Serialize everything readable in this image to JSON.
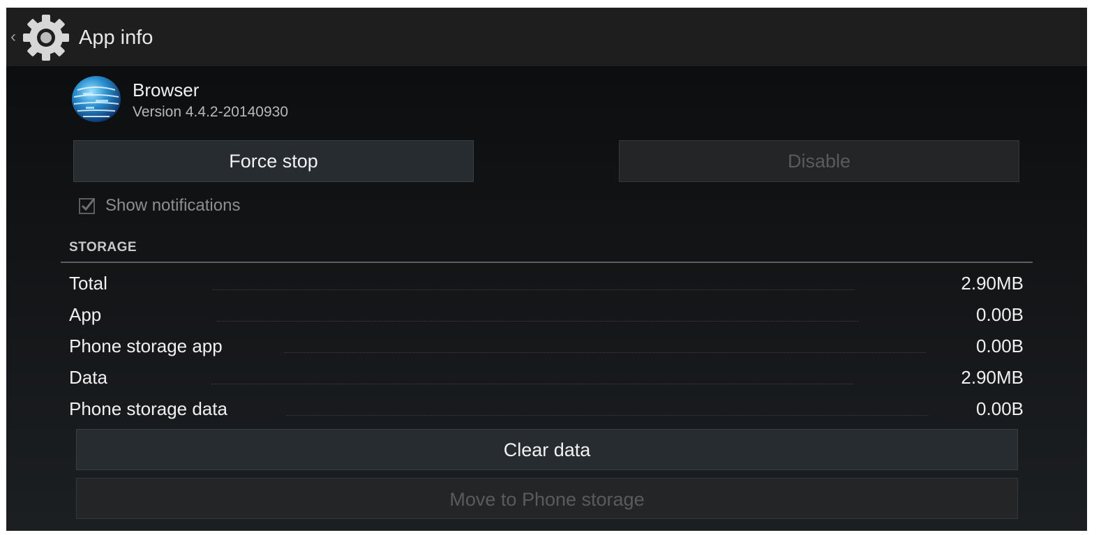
{
  "action_bar": {
    "title": "App info",
    "icon": "gear-icon"
  },
  "app": {
    "name": "Browser",
    "version": "Version 4.4.2-20140930",
    "icon": "globe-icon"
  },
  "buttons": {
    "force_stop": "Force stop",
    "disable": "Disable",
    "clear_data": "Clear data",
    "move_storage": "Move to Phone storage"
  },
  "notifications": {
    "label": "Show notifications",
    "checked": true
  },
  "storage": {
    "header": "STORAGE",
    "rows": [
      {
        "label": "Total",
        "value": "2.90MB"
      },
      {
        "label": "App",
        "value": "0.00B"
      },
      {
        "label": "Phone storage app",
        "value": "0.00B"
      },
      {
        "label": "Data",
        "value": "2.90MB"
      },
      {
        "label": "Phone storage data",
        "value": "0.00B"
      }
    ]
  },
  "colors": {
    "background": "#121416",
    "action_bar": "#1e1e1e",
    "text_primary": "#f0f0f0",
    "text_disabled": "#595c5f"
  }
}
